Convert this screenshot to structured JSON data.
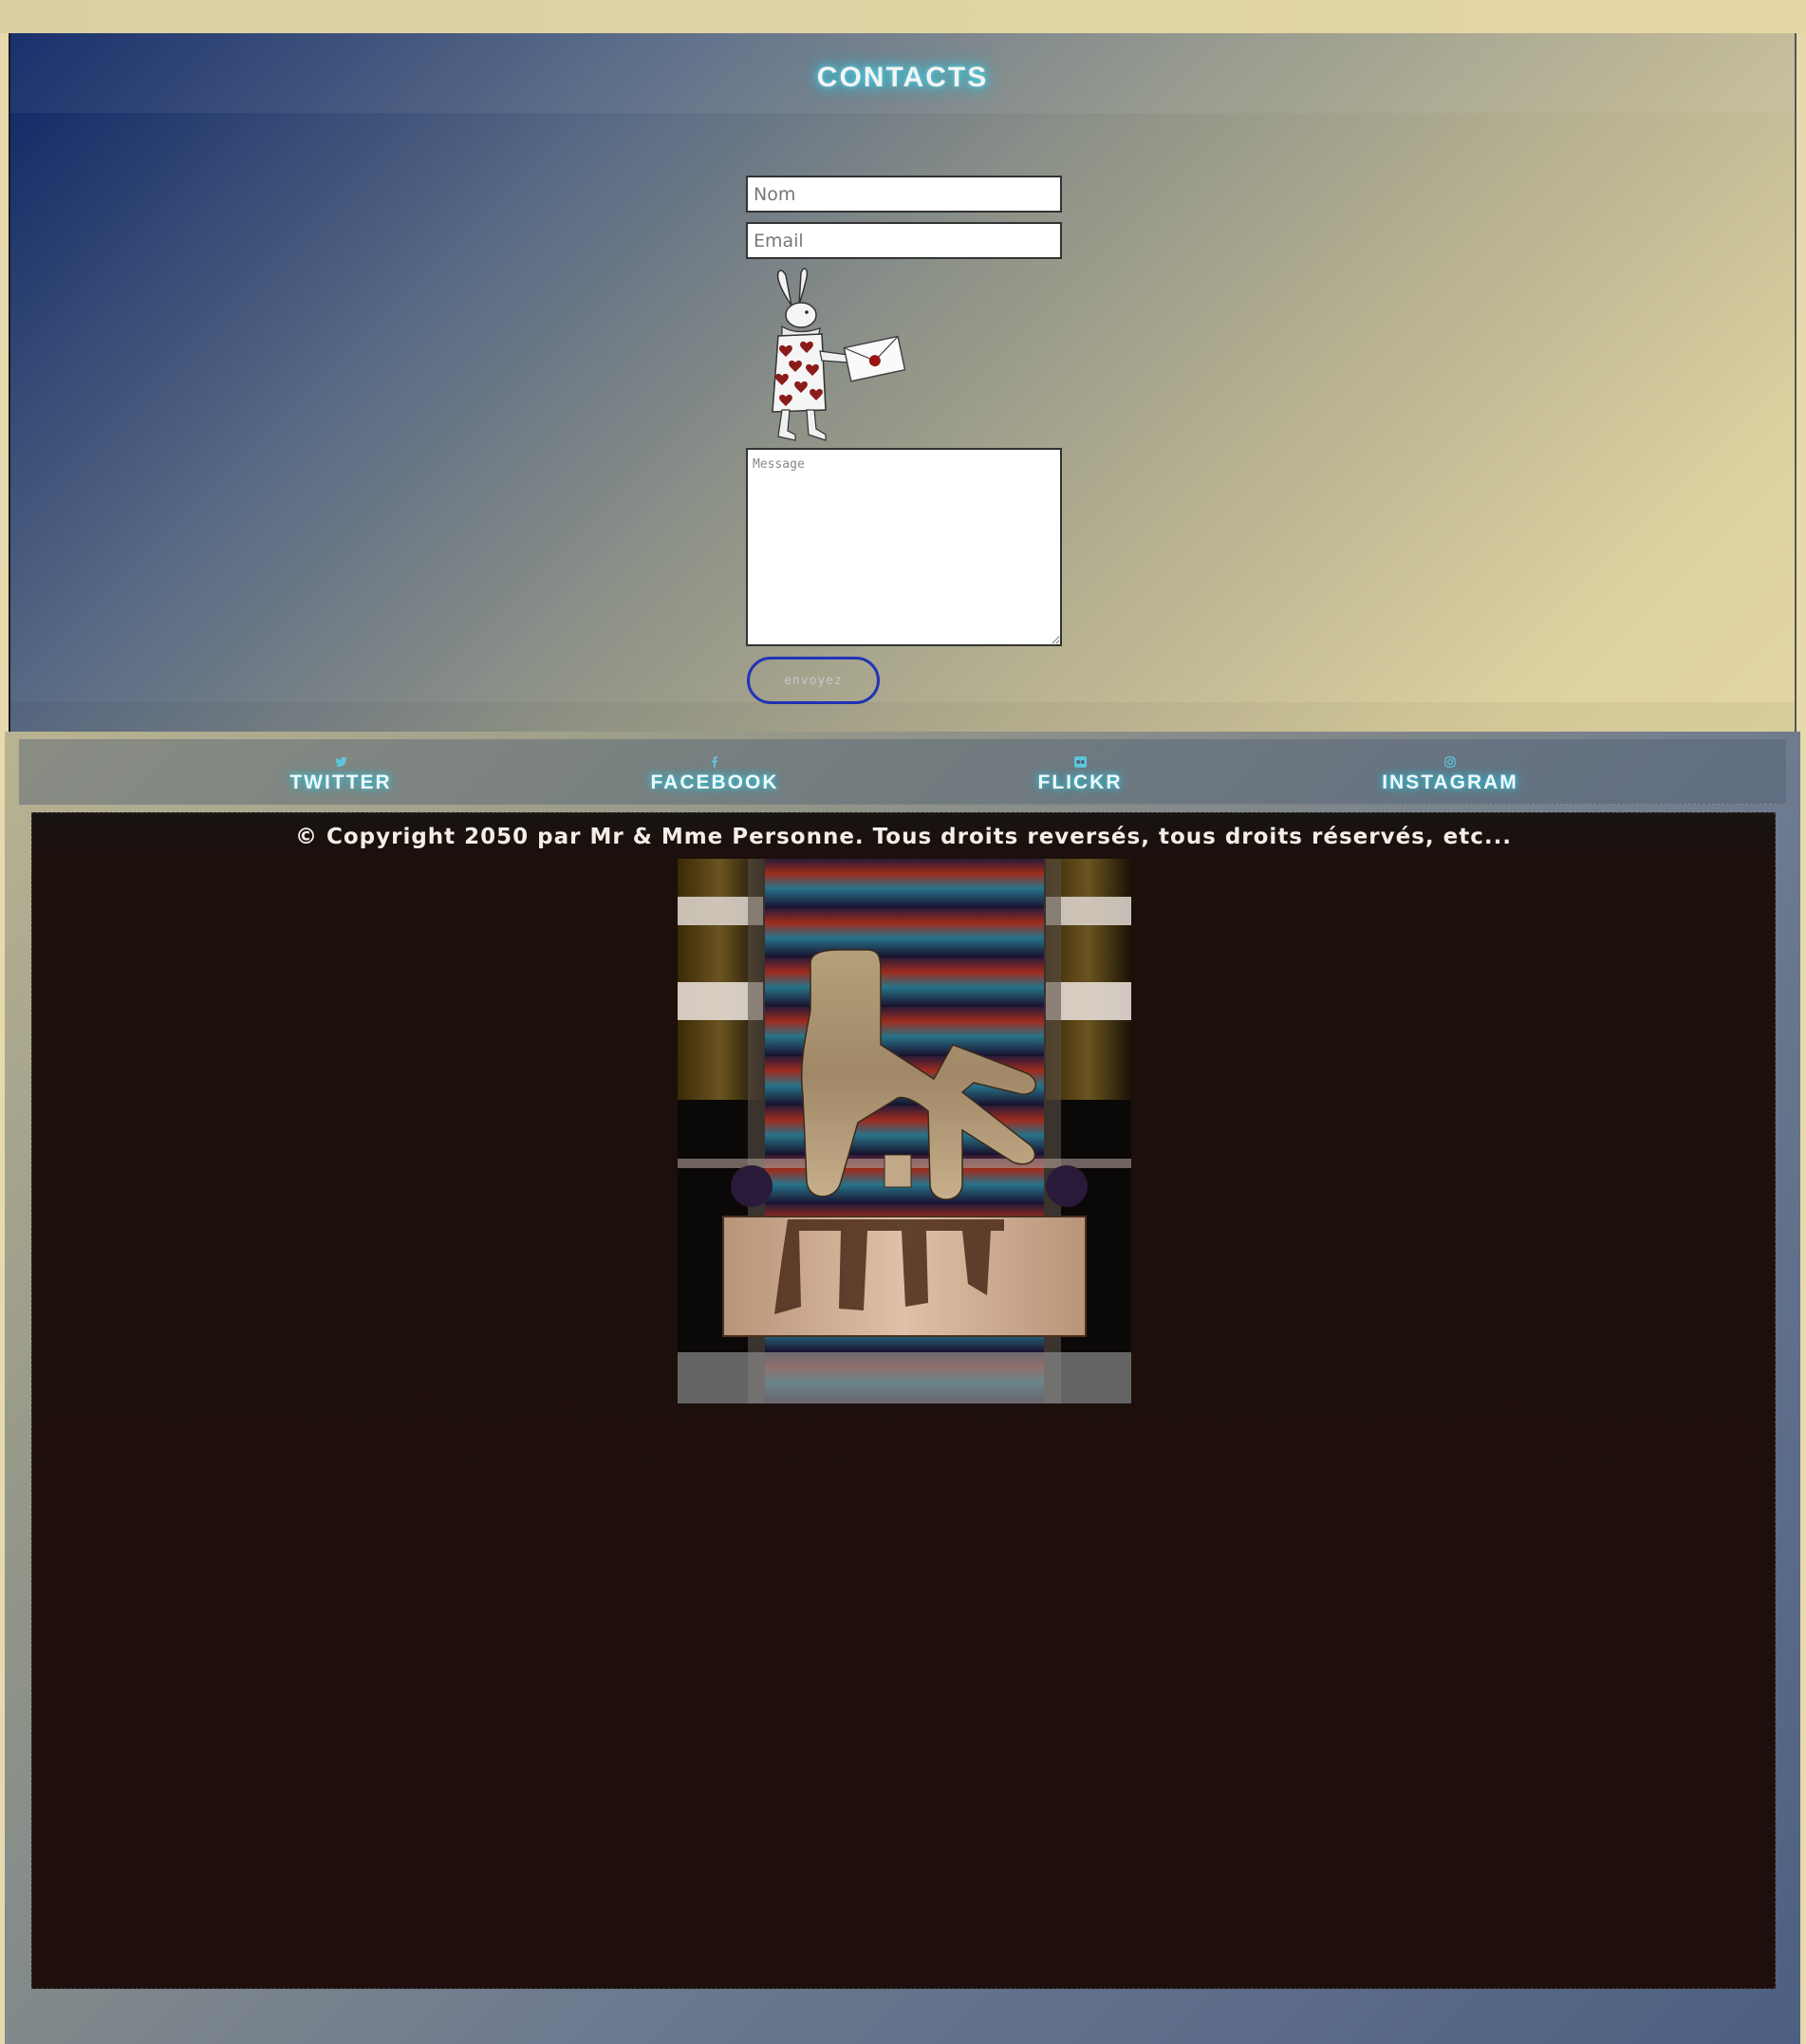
{
  "contact": {
    "title": "CONTACTS",
    "name_placeholder": "Nom",
    "email_placeholder": "Email",
    "message_placeholder": "Message",
    "send_label": "envoyez"
  },
  "social": {
    "items": [
      {
        "label": "TWITTER",
        "icon": "twitter-icon"
      },
      {
        "label": "FACEBOOK",
        "icon": "facebook-icon"
      },
      {
        "label": "FLICKR",
        "icon": "flickr-icon"
      },
      {
        "label": "INSTAGRAM",
        "icon": "instagram-icon"
      }
    ]
  },
  "footer": {
    "copyright": "© Copyright 2050 par Mr & Mme Personne. Tous droits reversés, tous droits réservés, etc..."
  },
  "colors": {
    "button_border": "#2233b8",
    "glow": "#3cc7dc",
    "footer_panel": "#1f0f0c"
  }
}
